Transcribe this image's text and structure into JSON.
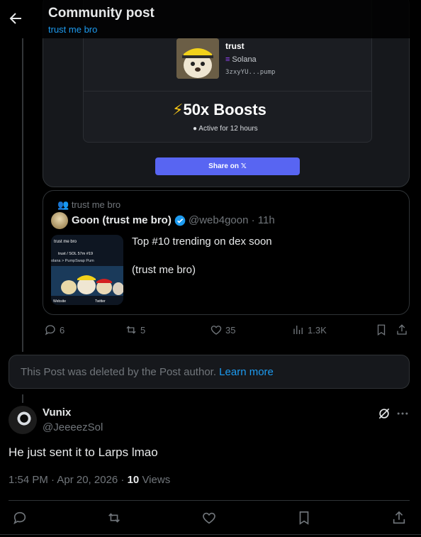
{
  "header": {
    "title": "Community post",
    "subtitle": "trust me bro"
  },
  "boost_card": {
    "token_name": "trust",
    "chain": "Solana",
    "address": "3zxyYU...pump",
    "boost_title": "50x Boosts",
    "boost_sub": "Active for 12 hours",
    "share_label": "Share on"
  },
  "quote": {
    "community": "trust me bro",
    "name": "Goon (trust me bro)",
    "handle": "@web4goon · 11h",
    "text_line1": "Top #10 trending on dex soon",
    "text_line2": "(trust me bro)",
    "thumb": {
      "title": "trust me bro",
      "line1": "trust / SOL  57m  #19",
      "line2": "olana > PumpSwap  Pum",
      "website": "Website",
      "twitter": "Twitter"
    }
  },
  "actions": {
    "replies": "6",
    "reposts": "5",
    "likes": "35",
    "views": "1.3K"
  },
  "deleted": {
    "text": "This Post was deleted by the Post author.",
    "link": "Learn more"
  },
  "reply": {
    "name": "Vunix",
    "handle": "@JeeeezSol",
    "text": "He just sent it to Larps lmao",
    "meta_time": "1:54 PM · Apr 20, 2026 · ",
    "views_count": "10",
    "views_label": " Views"
  },
  "colors": {
    "accent": "#1d9bf0",
    "muted": "#71767b",
    "discord": "#5865f2",
    "bolt": "#f5c518"
  }
}
